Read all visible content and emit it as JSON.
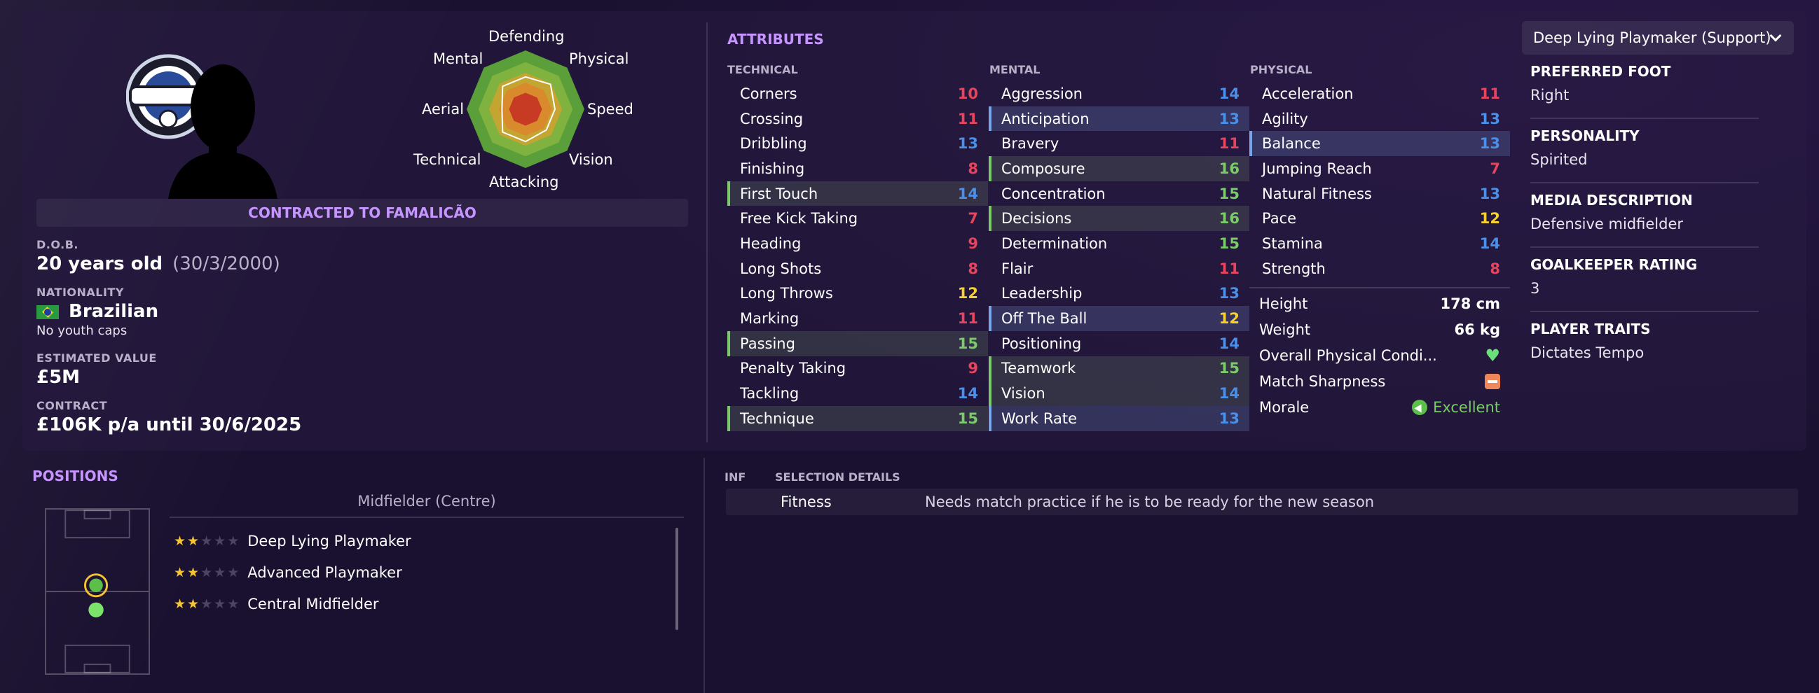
{
  "colors": {
    "accent": "#c695ff",
    "value_red": "#e8445e",
    "value_blue": "#4a8fe8",
    "value_green": "#7ccb6a",
    "value_yellow": "#f5d02f",
    "background": "#1a1130"
  },
  "profile": {
    "contracted_to": "CONTRACTED TO FAMALICÃO",
    "dob_label": "D.O.B.",
    "age": "20 years old",
    "dob_date": "(30/3/2000)",
    "nationality_label": "NATIONALITY",
    "nationality": "Brazilian",
    "flag_icon": "brazil-flag-icon",
    "youth_caps": "No youth caps",
    "value_label": "ESTIMATED VALUE",
    "value": "£5M",
    "contract_label": "CONTRACT",
    "contract": "£106K p/a until 30/6/2025"
  },
  "radar": {
    "labels": {
      "defending": "Defending",
      "physical": "Physical",
      "speed": "Speed",
      "vision": "Vision",
      "attacking": "Attacking",
      "technical": "Technical",
      "aerial": "Aerial",
      "mental": "Mental"
    },
    "player_profile": [
      0.55,
      0.6,
      0.5,
      0.5,
      0.55,
      0.55,
      0.4,
      0.55
    ]
  },
  "attributes": {
    "title": "ATTRIBUTES",
    "technical": {
      "heading": "TECHNICAL",
      "rows": [
        {
          "name": "Corners",
          "value": "10",
          "color": "red",
          "hl": ""
        },
        {
          "name": "Crossing",
          "value": "11",
          "color": "red",
          "hl": ""
        },
        {
          "name": "Dribbling",
          "value": "13",
          "color": "blue",
          "hl": ""
        },
        {
          "name": "Finishing",
          "value": "8",
          "color": "red",
          "hl": ""
        },
        {
          "name": "First Touch",
          "value": "14",
          "color": "blue",
          "hl": "green"
        },
        {
          "name": "Free Kick Taking",
          "value": "7",
          "color": "red",
          "hl": ""
        },
        {
          "name": "Heading",
          "value": "9",
          "color": "red",
          "hl": ""
        },
        {
          "name": "Long Shots",
          "value": "8",
          "color": "red",
          "hl": ""
        },
        {
          "name": "Long Throws",
          "value": "12",
          "color": "yellow",
          "hl": ""
        },
        {
          "name": "Marking",
          "value": "11",
          "color": "red",
          "hl": ""
        },
        {
          "name": "Passing",
          "value": "15",
          "color": "green",
          "hl": "green"
        },
        {
          "name": "Penalty Taking",
          "value": "9",
          "color": "red",
          "hl": ""
        },
        {
          "name": "Tackling",
          "value": "14",
          "color": "blue",
          "hl": ""
        },
        {
          "name": "Technique",
          "value": "15",
          "color": "green",
          "hl": "green"
        }
      ]
    },
    "mental": {
      "heading": "MENTAL",
      "rows": [
        {
          "name": "Aggression",
          "value": "14",
          "color": "blue",
          "hl": ""
        },
        {
          "name": "Anticipation",
          "value": "13",
          "color": "blue",
          "hl": "blue"
        },
        {
          "name": "Bravery",
          "value": "11",
          "color": "red",
          "hl": ""
        },
        {
          "name": "Composure",
          "value": "16",
          "color": "green",
          "hl": "green"
        },
        {
          "name": "Concentration",
          "value": "15",
          "color": "green",
          "hl": ""
        },
        {
          "name": "Decisions",
          "value": "16",
          "color": "green",
          "hl": "green"
        },
        {
          "name": "Determination",
          "value": "15",
          "color": "green",
          "hl": ""
        },
        {
          "name": "Flair",
          "value": "11",
          "color": "red",
          "hl": ""
        },
        {
          "name": "Leadership",
          "value": "13",
          "color": "blue",
          "hl": ""
        },
        {
          "name": "Off The Ball",
          "value": "12",
          "color": "yellow",
          "hl": "blue"
        },
        {
          "name": "Positioning",
          "value": "14",
          "color": "blue",
          "hl": ""
        },
        {
          "name": "Teamwork",
          "value": "15",
          "color": "green",
          "hl": "green"
        },
        {
          "name": "Vision",
          "value": "14",
          "color": "blue",
          "hl": "green"
        },
        {
          "name": "Work Rate",
          "value": "13",
          "color": "blue",
          "hl": "blue"
        }
      ]
    },
    "physical": {
      "heading": "PHYSICAL",
      "rows": [
        {
          "name": "Acceleration",
          "value": "11",
          "color": "red",
          "hl": ""
        },
        {
          "name": "Agility",
          "value": "13",
          "color": "blue",
          "hl": ""
        },
        {
          "name": "Balance",
          "value": "13",
          "color": "blue",
          "hl": "blue"
        },
        {
          "name": "Jumping Reach",
          "value": "7",
          "color": "red",
          "hl": ""
        },
        {
          "name": "Natural Fitness",
          "value": "13",
          "color": "blue",
          "hl": ""
        },
        {
          "name": "Pace",
          "value": "12",
          "color": "yellow",
          "hl": ""
        },
        {
          "name": "Stamina",
          "value": "14",
          "color": "blue",
          "hl": ""
        },
        {
          "name": "Strength",
          "value": "8",
          "color": "red",
          "hl": ""
        }
      ],
      "height_label": "Height",
      "height": "178 cm",
      "weight_label": "Weight",
      "weight": "66 kg",
      "condition_label": "Overall Physical Condi...",
      "condition_icon": "heart-icon",
      "sharpness_label": "Match Sharpness",
      "sharpness_icon": "minus-box-icon",
      "morale_label": "Morale",
      "morale": "Excellent"
    }
  },
  "side": {
    "role_dropdown": "Deep Lying Playmaker (Support)",
    "preferred_foot_label": "PREFERRED FOOT",
    "preferred_foot": "Right",
    "personality_label": "PERSONALITY",
    "personality": "Spirited",
    "media_label": "MEDIA DESCRIPTION",
    "media": "Defensive midfielder",
    "gk_label": "GOALKEEPER RATING",
    "gk": "3",
    "traits_label": "PLAYER TRAITS",
    "traits": "Dictates Tempo"
  },
  "positions": {
    "title": "POSITIONS",
    "position_name": "Midfielder (Centre)",
    "roles": [
      {
        "name": "Deep Lying Playmaker",
        "stars": 2
      },
      {
        "name": "Advanced Playmaker",
        "stars": 2
      },
      {
        "name": "Central Midfielder",
        "stars": 2
      }
    ]
  },
  "selection": {
    "inf_label": "INF",
    "details_label": "SELECTION DETAILS",
    "row_type": "Fitness",
    "row_text": "Needs match practice if he is to be ready for the new season"
  }
}
